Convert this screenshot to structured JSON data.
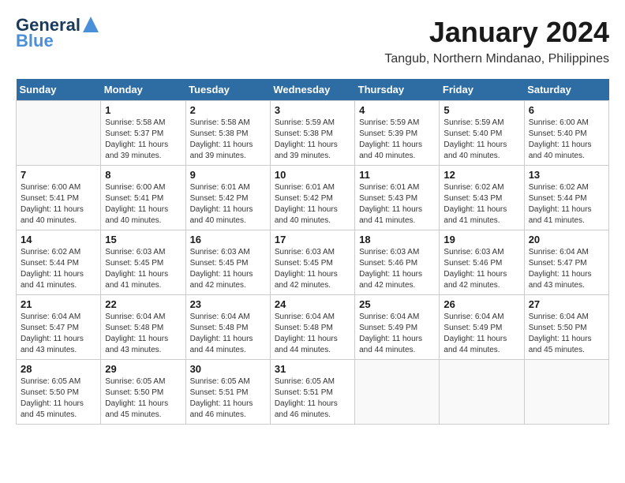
{
  "logo": {
    "line1": "General",
    "line2": "Blue"
  },
  "title": "January 2024",
  "subtitle": "Tangub, Northern Mindanao, Philippines",
  "days_of_week": [
    "Sunday",
    "Monday",
    "Tuesday",
    "Wednesday",
    "Thursday",
    "Friday",
    "Saturday"
  ],
  "weeks": [
    [
      {
        "day": "",
        "info": ""
      },
      {
        "day": "1",
        "info": "Sunrise: 5:58 AM\nSunset: 5:37 PM\nDaylight: 11 hours\nand 39 minutes."
      },
      {
        "day": "2",
        "info": "Sunrise: 5:58 AM\nSunset: 5:38 PM\nDaylight: 11 hours\nand 39 minutes."
      },
      {
        "day": "3",
        "info": "Sunrise: 5:59 AM\nSunset: 5:38 PM\nDaylight: 11 hours\nand 39 minutes."
      },
      {
        "day": "4",
        "info": "Sunrise: 5:59 AM\nSunset: 5:39 PM\nDaylight: 11 hours\nand 40 minutes."
      },
      {
        "day": "5",
        "info": "Sunrise: 5:59 AM\nSunset: 5:40 PM\nDaylight: 11 hours\nand 40 minutes."
      },
      {
        "day": "6",
        "info": "Sunrise: 6:00 AM\nSunset: 5:40 PM\nDaylight: 11 hours\nand 40 minutes."
      }
    ],
    [
      {
        "day": "7",
        "info": "Sunrise: 6:00 AM\nSunset: 5:41 PM\nDaylight: 11 hours\nand 40 minutes."
      },
      {
        "day": "8",
        "info": "Sunrise: 6:00 AM\nSunset: 5:41 PM\nDaylight: 11 hours\nand 40 minutes."
      },
      {
        "day": "9",
        "info": "Sunrise: 6:01 AM\nSunset: 5:42 PM\nDaylight: 11 hours\nand 40 minutes."
      },
      {
        "day": "10",
        "info": "Sunrise: 6:01 AM\nSunset: 5:42 PM\nDaylight: 11 hours\nand 40 minutes."
      },
      {
        "day": "11",
        "info": "Sunrise: 6:01 AM\nSunset: 5:43 PM\nDaylight: 11 hours\nand 41 minutes."
      },
      {
        "day": "12",
        "info": "Sunrise: 6:02 AM\nSunset: 5:43 PM\nDaylight: 11 hours\nand 41 minutes."
      },
      {
        "day": "13",
        "info": "Sunrise: 6:02 AM\nSunset: 5:44 PM\nDaylight: 11 hours\nand 41 minutes."
      }
    ],
    [
      {
        "day": "14",
        "info": "Sunrise: 6:02 AM\nSunset: 5:44 PM\nDaylight: 11 hours\nand 41 minutes."
      },
      {
        "day": "15",
        "info": "Sunrise: 6:03 AM\nSunset: 5:45 PM\nDaylight: 11 hours\nand 41 minutes."
      },
      {
        "day": "16",
        "info": "Sunrise: 6:03 AM\nSunset: 5:45 PM\nDaylight: 11 hours\nand 42 minutes."
      },
      {
        "day": "17",
        "info": "Sunrise: 6:03 AM\nSunset: 5:45 PM\nDaylight: 11 hours\nand 42 minutes."
      },
      {
        "day": "18",
        "info": "Sunrise: 6:03 AM\nSunset: 5:46 PM\nDaylight: 11 hours\nand 42 minutes."
      },
      {
        "day": "19",
        "info": "Sunrise: 6:03 AM\nSunset: 5:46 PM\nDaylight: 11 hours\nand 42 minutes."
      },
      {
        "day": "20",
        "info": "Sunrise: 6:04 AM\nSunset: 5:47 PM\nDaylight: 11 hours\nand 43 minutes."
      }
    ],
    [
      {
        "day": "21",
        "info": "Sunrise: 6:04 AM\nSunset: 5:47 PM\nDaylight: 11 hours\nand 43 minutes."
      },
      {
        "day": "22",
        "info": "Sunrise: 6:04 AM\nSunset: 5:48 PM\nDaylight: 11 hours\nand 43 minutes."
      },
      {
        "day": "23",
        "info": "Sunrise: 6:04 AM\nSunset: 5:48 PM\nDaylight: 11 hours\nand 44 minutes."
      },
      {
        "day": "24",
        "info": "Sunrise: 6:04 AM\nSunset: 5:48 PM\nDaylight: 11 hours\nand 44 minutes."
      },
      {
        "day": "25",
        "info": "Sunrise: 6:04 AM\nSunset: 5:49 PM\nDaylight: 11 hours\nand 44 minutes."
      },
      {
        "day": "26",
        "info": "Sunrise: 6:04 AM\nSunset: 5:49 PM\nDaylight: 11 hours\nand 44 minutes."
      },
      {
        "day": "27",
        "info": "Sunrise: 6:04 AM\nSunset: 5:50 PM\nDaylight: 11 hours\nand 45 minutes."
      }
    ],
    [
      {
        "day": "28",
        "info": "Sunrise: 6:05 AM\nSunset: 5:50 PM\nDaylight: 11 hours\nand 45 minutes."
      },
      {
        "day": "29",
        "info": "Sunrise: 6:05 AM\nSunset: 5:50 PM\nDaylight: 11 hours\nand 45 minutes."
      },
      {
        "day": "30",
        "info": "Sunrise: 6:05 AM\nSunset: 5:51 PM\nDaylight: 11 hours\nand 46 minutes."
      },
      {
        "day": "31",
        "info": "Sunrise: 6:05 AM\nSunset: 5:51 PM\nDaylight: 11 hours\nand 46 minutes."
      },
      {
        "day": "",
        "info": ""
      },
      {
        "day": "",
        "info": ""
      },
      {
        "day": "",
        "info": ""
      }
    ]
  ]
}
